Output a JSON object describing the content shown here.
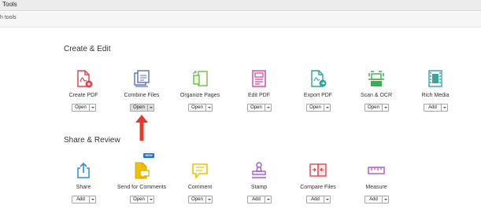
{
  "topbar": {
    "tab_label": "Tools"
  },
  "search": {
    "text": "h tools"
  },
  "sections": {
    "create_edit": "Create & Edit",
    "share_review": "Share & Review"
  },
  "tools": {
    "create_pdf": {
      "label": "Create PDF",
      "button": "Open",
      "icon": "create-pdf-icon",
      "color": "#e1464d"
    },
    "combine_files": {
      "label": "Combine Files",
      "button": "Open",
      "icon": "combine-files-icon",
      "color": "#5c6bc0"
    },
    "organize_pages": {
      "label": "Organize Pages",
      "button": "Open",
      "icon": "organize-pages-icon",
      "color": "#6bbd45"
    },
    "edit_pdf": {
      "label": "Edit PDF",
      "button": "Open",
      "icon": "edit-pdf-icon",
      "color": "#d6409f"
    },
    "export_pdf": {
      "label": "Export PDF",
      "button": "Open",
      "icon": "export-pdf-icon",
      "color": "#26a69a"
    },
    "scan_ocr": {
      "label": "Scan & OCR",
      "button": "Open",
      "icon": "scan-ocr-icon",
      "color": "#35b34a"
    },
    "rich_media": {
      "label": "Rich Media",
      "button": "Add",
      "icon": "rich-media-icon",
      "color": "#3aa3a1"
    },
    "share": {
      "label": "Share",
      "button": "Add",
      "icon": "share-icon",
      "color": "#2d8ceb"
    },
    "send_for_comments": {
      "label": "Send for Comments",
      "button": "Open",
      "icon": "send-for-comments-icon",
      "color": "#f2c200",
      "badge": "NEW"
    },
    "comment": {
      "label": "Comment",
      "button": "Open",
      "icon": "comment-icon",
      "color": "#f2c200"
    },
    "stamp": {
      "label": "Stamp",
      "button": "Add",
      "icon": "stamp-icon",
      "color": "#9c5bd6"
    },
    "compare_files": {
      "label": "Compare Files",
      "button": "Add",
      "icon": "compare-files-icon",
      "color": "#e1464d"
    },
    "measure": {
      "label": "Measure",
      "button": "Add",
      "icon": "measure-icon",
      "color": "#b35fd0"
    }
  },
  "annotation": {
    "arrow_color": "#e8372e"
  }
}
